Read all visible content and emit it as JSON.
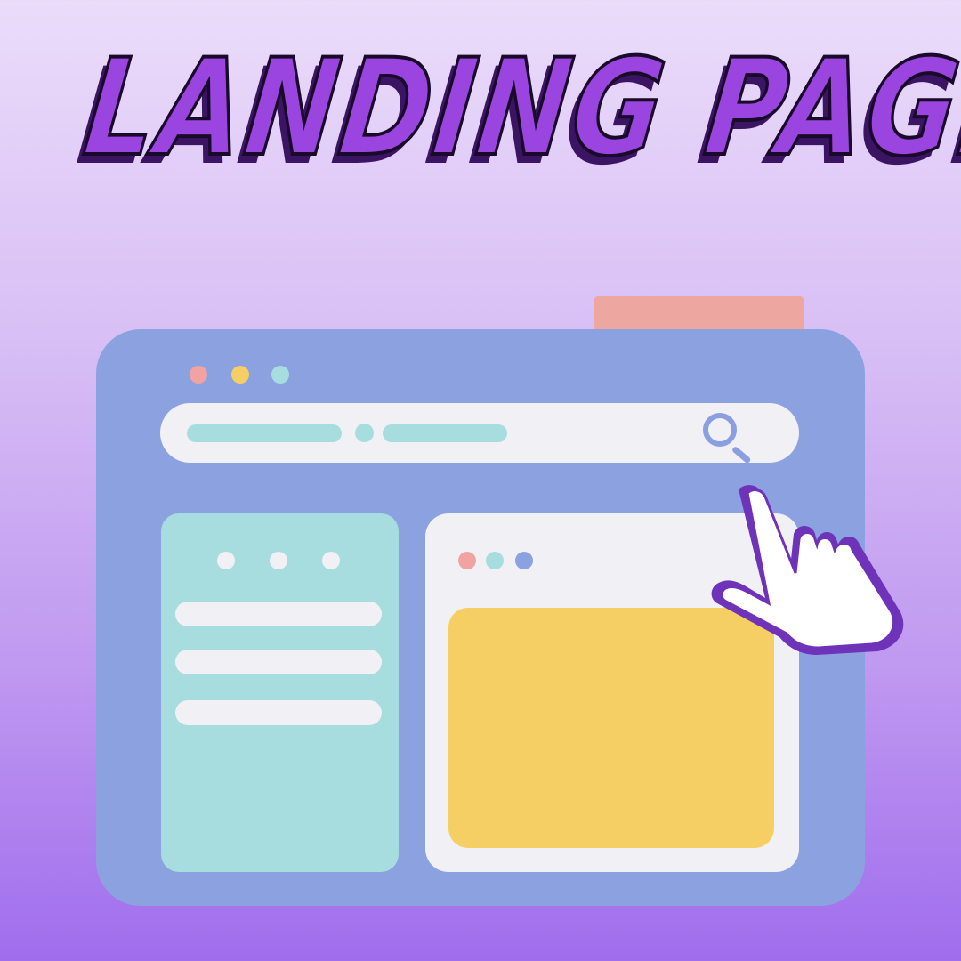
{
  "heading": {
    "text": "LANDING PAGE"
  },
  "colors": {
    "title_fill": "#9a45e0",
    "title_stroke": "#1a0a2a",
    "title_shadow": "#3b1463",
    "window": "#8ba1e0",
    "tab": "#eea6a0",
    "teal": "#a7ddde",
    "yellow": "#f5cf63",
    "dot_red": "#f0a3a0",
    "dot_yellow": "#f5cf63",
    "dot_teal": "#a7ddde",
    "dot_blue": "#8ba1e0",
    "cursor_fill": "#ffffff",
    "cursor_edge": "#6e33b8"
  },
  "icons": {
    "search": "search-icon",
    "pointer": "pointing-hand-cursor-icon"
  }
}
